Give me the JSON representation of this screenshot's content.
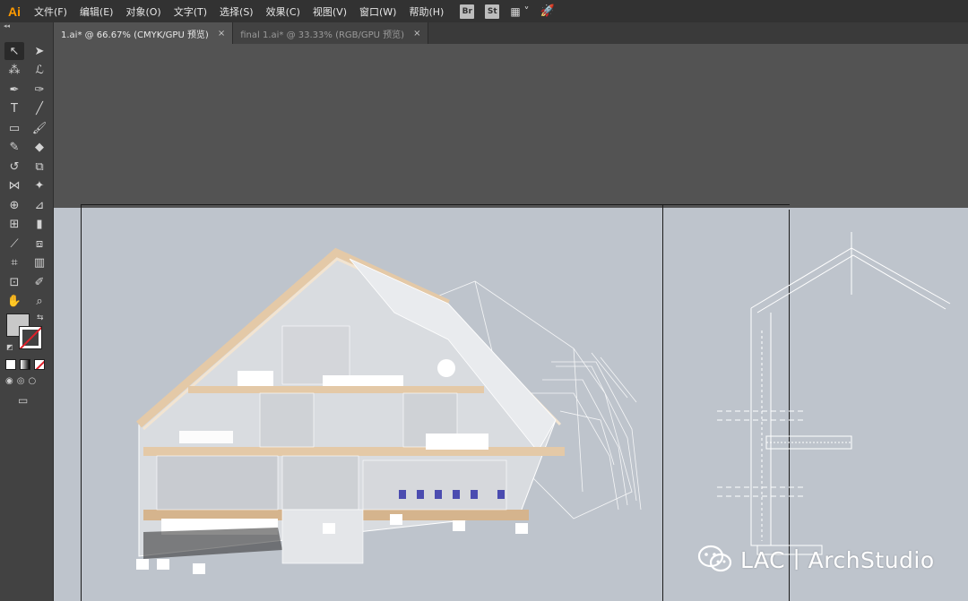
{
  "app": {
    "logo": "Ai"
  },
  "menu": [
    "文件(F)",
    "编辑(E)",
    "对象(O)",
    "文字(T)",
    "选择(S)",
    "效果(C)",
    "视图(V)",
    "窗口(W)",
    "帮助(H)"
  ],
  "menu_buttons": {
    "bridge": "Br",
    "stock": "St"
  },
  "tabs": [
    {
      "label": "1.ai* @ 66.67% (CMYK/GPU 预览)",
      "close": "×",
      "active": true
    },
    {
      "label": "final 1.ai* @ 33.33% (RGB/GPU 预览)",
      "close": "×",
      "active": false
    }
  ],
  "tools": {
    "grip": "◂◂",
    "rows": [
      [
        "selection-icon",
        "direct-selection-icon"
      ],
      [
        "magic-wand-icon",
        "lasso-icon"
      ],
      [
        "pen-icon",
        "curvature-icon"
      ],
      [
        "type-icon",
        "line-segment-icon"
      ],
      [
        "rectangle-icon",
        "paintbrush-icon"
      ],
      [
        "shaper-icon",
        "eraser-icon"
      ],
      [
        "rotate-icon",
        "scale-icon"
      ],
      [
        "width-icon",
        "puppet-warp-icon"
      ],
      [
        "shape-builder-icon",
        "perspective-grid-icon"
      ],
      [
        "mesh-icon",
        "gradient-icon"
      ],
      [
        "eyedropper-icon",
        "blend-icon"
      ],
      [
        "symbol-sprayer-icon",
        "column-graph-icon"
      ],
      [
        "artboard-icon",
        "slice-icon"
      ],
      [
        "hand-icon",
        "zoom-icon"
      ]
    ],
    "glyphs": {
      "selection-icon": "↖",
      "direct-selection-icon": "➤",
      "magic-wand-icon": "⁂",
      "lasso-icon": "ℒ",
      "pen-icon": "✒",
      "curvature-icon": "✑",
      "type-icon": "T",
      "line-segment-icon": "╱",
      "rectangle-icon": "▭",
      "paintbrush-icon": "🖌",
      "shaper-icon": "✎",
      "eraser-icon": "◆",
      "rotate-icon": "↺",
      "scale-icon": "⧉",
      "width-icon": "⋈",
      "puppet-warp-icon": "✦",
      "shape-builder-icon": "⊕",
      "perspective-grid-icon": "⊿",
      "mesh-icon": "⊞",
      "gradient-icon": "▮",
      "eyedropper-icon": "⟋",
      "blend-icon": "⧈",
      "symbol-sprayer-icon": "⌗",
      "column-graph-icon": "▥",
      "artboard-icon": "⊡",
      "slice-icon": "✐",
      "hand-icon": "✋",
      "zoom-icon": "⌕"
    },
    "swap": "⇆",
    "default": "◩",
    "draw_modes": [
      "◉",
      "◎",
      "○"
    ],
    "screen_mode": "▭"
  },
  "watermark": {
    "text": "LAC丨ArchStudio"
  },
  "colors": {
    "menubar": "#323232",
    "panel": "#424242",
    "canvas": "#535353",
    "pasteboard": "#bec4cc",
    "logo": "#ff9a00"
  }
}
